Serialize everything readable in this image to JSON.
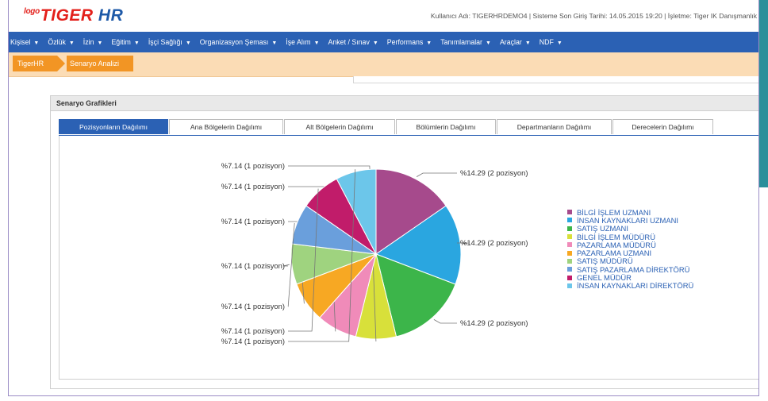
{
  "header": {
    "logo_small": "logo",
    "logo_tiger": "TIGER ",
    "logo_hr": "HR",
    "user_info": "Kullanıcı Adı: TIGERHRDEMO4 | Sisteme Son Giriş Tarihi: 14.05.2015 19:20 | İşletme: Tiger IK Danışmanlık"
  },
  "nav": {
    "items": [
      "Kişisel",
      "Özlük",
      "İzin",
      "Eğitim",
      "İşçi Sağlığı",
      "Organizasyon Şeması",
      "İşe Alım",
      "Anket / Sınav",
      "Performans",
      "Tanımlamalar",
      "Araçlar",
      "NDF"
    ]
  },
  "breadcrumb": {
    "root": "TigerHR",
    "current": "Senaryo Analizi"
  },
  "panel": {
    "title": "Senaryo Grafikleri"
  },
  "tabs": [
    {
      "label": "Pozisyonların Dağılımı",
      "active": true
    },
    {
      "label": "Ana Bölgelerin Dağılımı",
      "active": false
    },
    {
      "label": "Alt Bölgelerin Dağılımı",
      "active": false
    },
    {
      "label": "Bölümlerin Dağılımı",
      "active": false
    },
    {
      "label": "Departmanların Dağılımı",
      "active": false
    },
    {
      "label": "Derecelerin Dağılımı",
      "active": false
    }
  ],
  "chart_data": {
    "type": "pie",
    "series": [
      {
        "name": "BİLGİ İŞLEM UZMANI",
        "value": 14.29,
        "count": 2,
        "label": "%14.29 (2 pozisyon)",
        "color": "#a64a8c"
      },
      {
        "name": "İNSAN KAYNAKLARI UZMANI",
        "value": 14.29,
        "count": 2,
        "label": "%14.29 (2 pozisyon)",
        "color": "#2aa6e0"
      },
      {
        "name": "SATIŞ UZMANI",
        "value": 14.29,
        "count": 2,
        "label": "%14.29 (2 pozisyon)",
        "color": "#3cb54a"
      },
      {
        "name": "BİLGİ İŞLEM MÜDÜRÜ",
        "value": 7.14,
        "count": 1,
        "label": "%7.14 (1 pozisyon)",
        "color": "#d8e03a"
      },
      {
        "name": "PAZARLAMA MÜDÜRÜ",
        "value": 7.14,
        "count": 1,
        "label": "%7.14 (1 pozisyon)",
        "color": "#f08bb9"
      },
      {
        "name": "PAZARLAMA UZMANI",
        "value": 7.14,
        "count": 1,
        "label": "%7.14 (1 pozisyon)",
        "color": "#f7a823"
      },
      {
        "name": "SATIŞ MÜDÜRÜ",
        "value": 7.14,
        "count": 1,
        "label": "%7.14 (1 pozisyon)",
        "color": "#9fd37f"
      },
      {
        "name": "SATIŞ PAZARLAMA DİREKTÖRÜ",
        "value": 7.14,
        "count": 1,
        "label": "%7.14 (1 pozisyon)",
        "color": "#6a9fdc"
      },
      {
        "name": "GENEL MÜDÜR",
        "value": 7.14,
        "count": 1,
        "label": "%7.14 (1 pozisyon)",
        "color": "#c11c6a"
      },
      {
        "name": "İNSAN KAYNAKLARI DİREKTÖRÜ",
        "value": 7.14,
        "count": 1,
        "label": "%7.14 (1 pozisyon)",
        "color": "#6cc6ea"
      }
    ],
    "legend": "right"
  }
}
